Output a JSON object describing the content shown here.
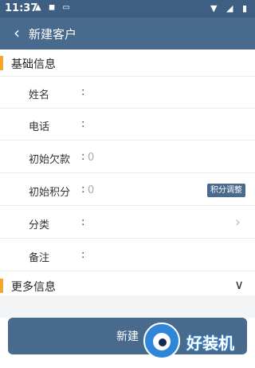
{
  "status_bar": {
    "time": "11:37",
    "left_icons": "▲ ◼ ▭",
    "right_icons": "▼ ◢ ▮"
  },
  "app_bar": {
    "back_icon": "‹",
    "title": "新建客户"
  },
  "basic_section": {
    "title": "基础信息",
    "accent_color": "#f4a72a"
  },
  "fields": [
    {
      "label": "姓名",
      "colon": ":",
      "value": ""
    },
    {
      "label": "电话",
      "colon": ":",
      "value": ""
    },
    {
      "label": "初始欠款",
      "colon": ":",
      "value": "",
      "placeholder": "0"
    },
    {
      "label": "初始积分",
      "colon": ":",
      "value": "",
      "placeholder": "0",
      "badge": "积分调整"
    },
    {
      "label": "分类",
      "colon": ":",
      "value": "",
      "arrow": "›"
    },
    {
      "label": "备注",
      "colon": ":",
      "value": ""
    }
  ],
  "more_section": {
    "title": "更多信息",
    "chevron": "∨"
  },
  "submit_button": {
    "label": "新建"
  },
  "watermark": {
    "text": "好装机"
  },
  "colors": {
    "primary": "#486a8d",
    "status_bar": "#3f5f82",
    "accent": "#f4a72a"
  }
}
